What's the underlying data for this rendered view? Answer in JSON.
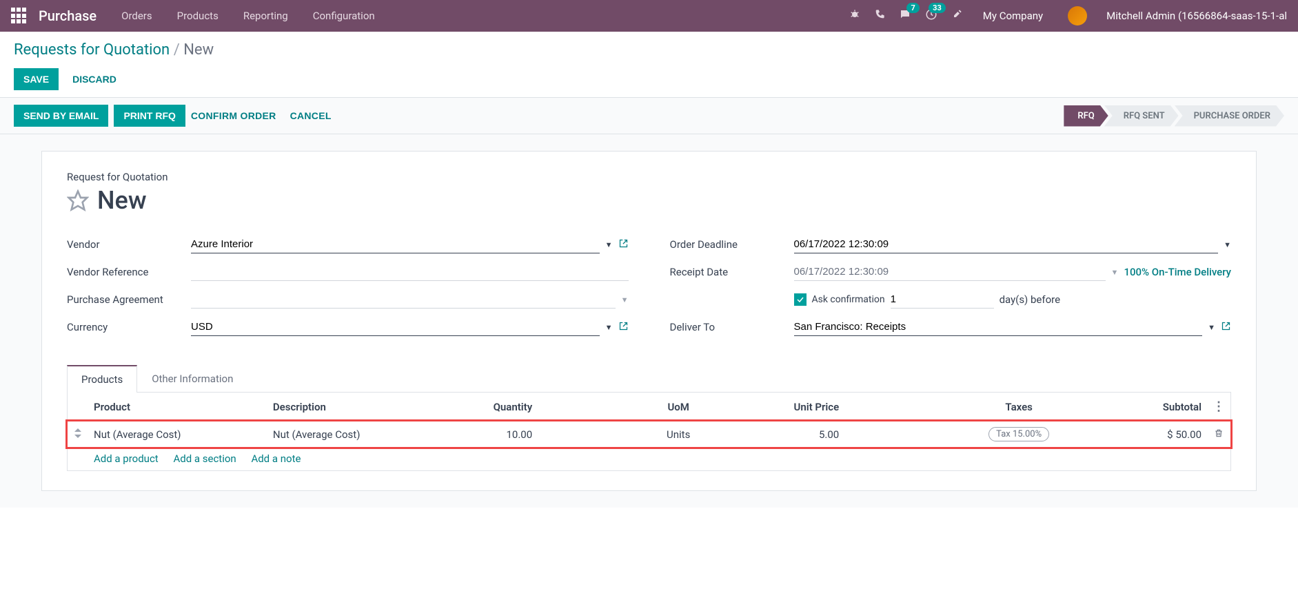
{
  "navbar": {
    "brand": "Purchase",
    "links": [
      "Orders",
      "Products",
      "Reporting",
      "Configuration"
    ],
    "messages_badge": "7",
    "activities_badge": "33",
    "company": "My Company",
    "user": "Mitchell Admin (16566864-saas-15-1-al"
  },
  "breadcrumb": {
    "root": "Requests for Quotation",
    "current": "New"
  },
  "control": {
    "save": "SAVE",
    "discard": "DISCARD"
  },
  "actions": {
    "send_email": "SEND BY EMAIL",
    "print_rfq": "PRINT RFQ",
    "confirm": "CONFIRM ORDER",
    "cancel": "CANCEL"
  },
  "status": {
    "rfq": "RFQ",
    "rfq_sent": "RFQ SENT",
    "po": "PURCHASE ORDER"
  },
  "form": {
    "title_label": "Request for Quotation",
    "title": "New",
    "labels": {
      "vendor": "Vendor",
      "vendor_ref": "Vendor Reference",
      "purchase_agreement": "Purchase Agreement",
      "currency": "Currency",
      "order_deadline": "Order Deadline",
      "receipt_date": "Receipt Date",
      "ask_confirmation": "Ask confirmation",
      "days_before": "day(s) before",
      "deliver_to": "Deliver To"
    },
    "values": {
      "vendor": "Azure Interior",
      "vendor_ref": "",
      "purchase_agreement": "",
      "currency": "USD",
      "order_deadline": "06/17/2022 12:30:09",
      "receipt_date": "06/17/2022 12:30:09",
      "on_time": "100% On-Time Delivery",
      "confirm_days": "1",
      "deliver_to": "San Francisco: Receipts"
    }
  },
  "tabs": {
    "products": "Products",
    "other": "Other Information"
  },
  "table": {
    "headers": {
      "product": "Product",
      "description": "Description",
      "quantity": "Quantity",
      "uom": "UoM",
      "unit_price": "Unit Price",
      "taxes": "Taxes",
      "subtotal": "Subtotal"
    },
    "rows": [
      {
        "product": "Nut (Average Cost)",
        "description": "Nut (Average Cost)",
        "quantity": "10.00",
        "uom": "Units",
        "unit_price": "5.00",
        "taxes": "Tax 15.00%",
        "subtotal": "$ 50.00"
      }
    ],
    "add_product": "Add a product",
    "add_section": "Add a section",
    "add_note": "Add a note"
  }
}
